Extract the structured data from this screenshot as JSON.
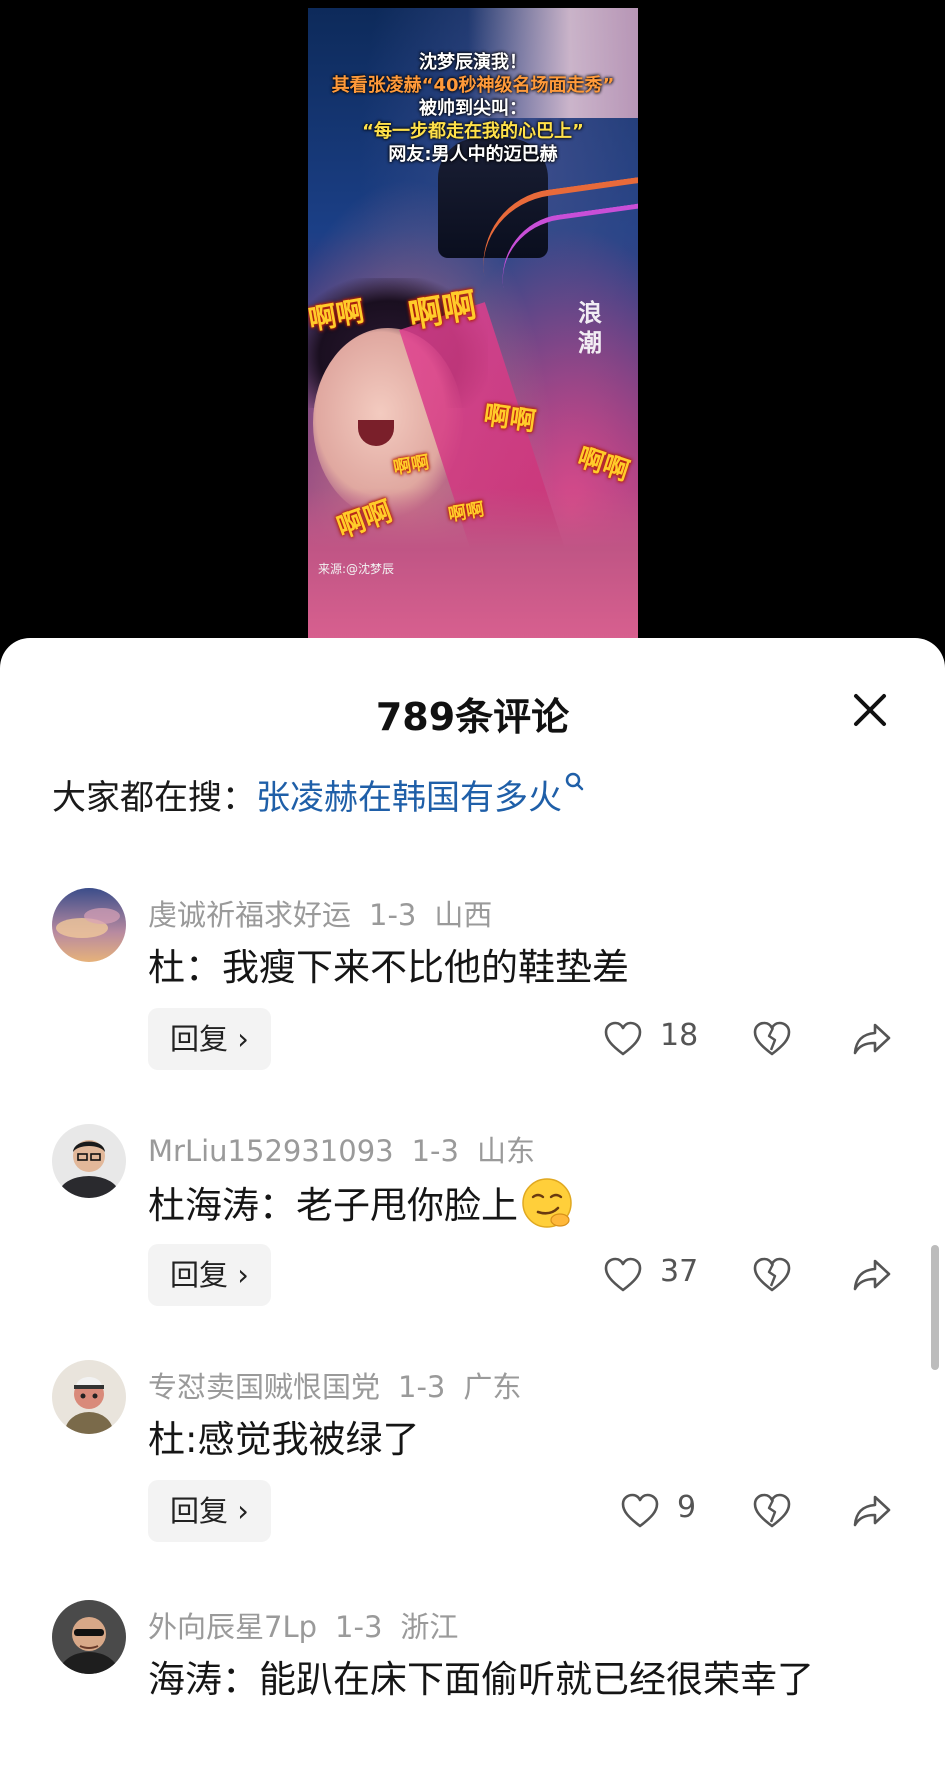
{
  "video": {
    "caption_lines": [
      "沈梦辰演我！",
      "其看张凌赫“40秒神级名场面走秀”",
      "被帅到尖叫：",
      "“每一步都走在我的心巴上”",
      "网友:男人中的迈巴赫"
    ],
    "sfx": [
      "啊啊",
      "啊啊",
      "啊啊",
      "啊啊",
      "啊啊",
      "啊啊",
      "啊啊"
    ],
    "watermark": "浪\n潮",
    "source": "来源:@沈梦辰"
  },
  "sheet": {
    "title": "789条评论",
    "close_icon": "close-icon",
    "search_prefix": "大家都在搜：",
    "search_query": "张凌赫在韩国有多火",
    "search_icon": "search-icon"
  },
  "comments": [
    {
      "user": "虔诚祈福求好运",
      "date": "1-3",
      "location": "山西",
      "text": "杜：我瘦下来不比他的鞋垫差",
      "reply_label": "回复 ›",
      "likes": "18"
    },
    {
      "user": "MrLiu152931093",
      "date": "1-3",
      "location": "山东",
      "text": "杜海涛：老子甩你脸上",
      "emoji": "smirk-face-emoji",
      "reply_label": "回复 ›",
      "likes": "37"
    },
    {
      "user": "专怼卖国贼恨国党",
      "date": "1-3",
      "location": "广东",
      "text": "杜:感觉我被绿了",
      "reply_label": "回复 ›",
      "likes": "9"
    },
    {
      "user": "外向辰星7Lp",
      "date": "1-3",
      "location": "浙江",
      "text": "海涛：能趴在床下面偷听就已经很荣幸了"
    }
  ],
  "colors": {
    "link": "#1f5fa8",
    "meta": "#9a9a9a",
    "sheet_bg": "#ffffff",
    "backdrop": "#000000"
  }
}
